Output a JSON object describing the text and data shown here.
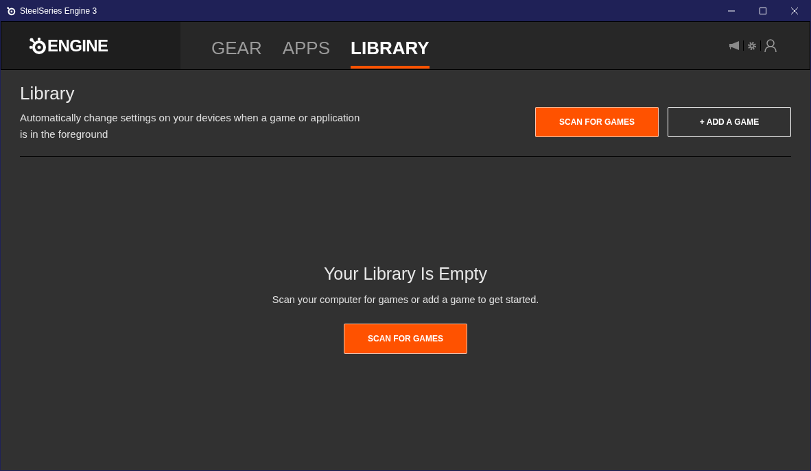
{
  "window": {
    "title": "SteelSeries Engine 3"
  },
  "logo": {
    "text": "ENGINE"
  },
  "tabs": [
    {
      "label": "GEAR",
      "selected": false
    },
    {
      "label": "APPS",
      "selected": false
    },
    {
      "label": "LIBRARY",
      "selected": true
    }
  ],
  "page": {
    "title": "Library",
    "description": "Automatically change settings on your devices when a game or application is in the foreground",
    "buttons": [
      {
        "label": "SCAN FOR GAMES",
        "kind": "primary"
      },
      {
        "label": "+ ADD A GAME",
        "kind": "outline"
      }
    ]
  },
  "empty_state": {
    "title": "Your Library Is Empty",
    "message": "Scan your computer for games or add a game to get started.",
    "button": {
      "label": "SCAN FOR GAMES",
      "kind": "primary"
    }
  }
}
